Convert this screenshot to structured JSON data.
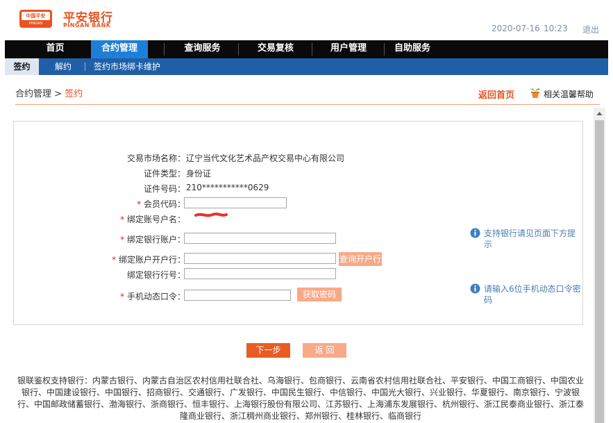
{
  "header": {
    "logo_badge_top": "中国平安",
    "logo_badge_bottom": "PINGAN",
    "logo_cn": "平安银行",
    "logo_en": "PINGAN BANK",
    "date": "2020-07-16",
    "time": "10:23",
    "logout": "退出",
    "brand_color": "#e9531f"
  },
  "topnav": {
    "items": [
      {
        "label": "首页",
        "active": false
      },
      {
        "label": "合约管理",
        "active": true
      },
      {
        "label": "查询服务",
        "active": false
      },
      {
        "label": "交易复核",
        "active": false
      },
      {
        "label": "用户管理",
        "active": false
      },
      {
        "label": "自助服务",
        "active": false
      }
    ]
  },
  "subnav": {
    "items": [
      {
        "label": "签约",
        "active": true
      },
      {
        "label": "解约",
        "active": false
      },
      {
        "label": "签约市场绑卡维护",
        "active": false
      }
    ]
  },
  "breadcrumb": {
    "parent": "合约管理",
    "separator": ">",
    "current": "签约"
  },
  "actions": {
    "back_home": "返回首页",
    "help": "相关温馨帮助",
    "help_icon": "plant-pot-icon"
  },
  "form": {
    "market_name_label": "交易市场名称：",
    "market_name_value": "辽宁当代文化艺术品产权交易中心有限公司",
    "id_type_label": "证件类型：",
    "id_type_value": "身份证",
    "id_number_label": "证件号码：",
    "id_number_value": "210***********0629",
    "member_code_label": "会员代码：",
    "member_code_value": "",
    "account_name_label": "绑定账号户名：",
    "bank_account_label": "绑定银行账户：",
    "bank_account_value": "",
    "open_bank_label": "绑定账户开户行：",
    "open_bank_value": "",
    "query_bank_button": "查询开户行",
    "bank_code_label": "绑定银行行号：",
    "bank_code_value": "",
    "otp_label": "手机动态口令：",
    "otp_value": "",
    "get_otp_button": "获取密码",
    "required_mark": "*"
  },
  "tips": {
    "bank_tip": "支持银行请见页面下方提示",
    "otp_tip": "请输入6位手机动态口令密码",
    "icon": "info-icon"
  },
  "buttons": {
    "next": "下一步",
    "back": "返 回"
  },
  "supported_banks": "银联鉴权支持银行：内蒙古银行、内蒙古自治区农村信用社联合社、乌海银行、包商银行、云南省农村信用社联合社、平安银行、中国工商银行、中国农业银行、中国建设银行、中国银行、招商银行、交通银行、广发银行、中国民生银行、中信银行、中国光大银行、兴业银行、华夏银行、南京银行、宁波银行、中国邮政储蓄银行、渤海银行、浙商银行、恒丰银行、上海银行股份有限公司、江苏银行、上海浦东发展银行、杭州银行、浙江民泰商业银行、浙江泰隆商业银行、浙江稠州商业银行、郑州银行、桂林银行、临商银行"
}
